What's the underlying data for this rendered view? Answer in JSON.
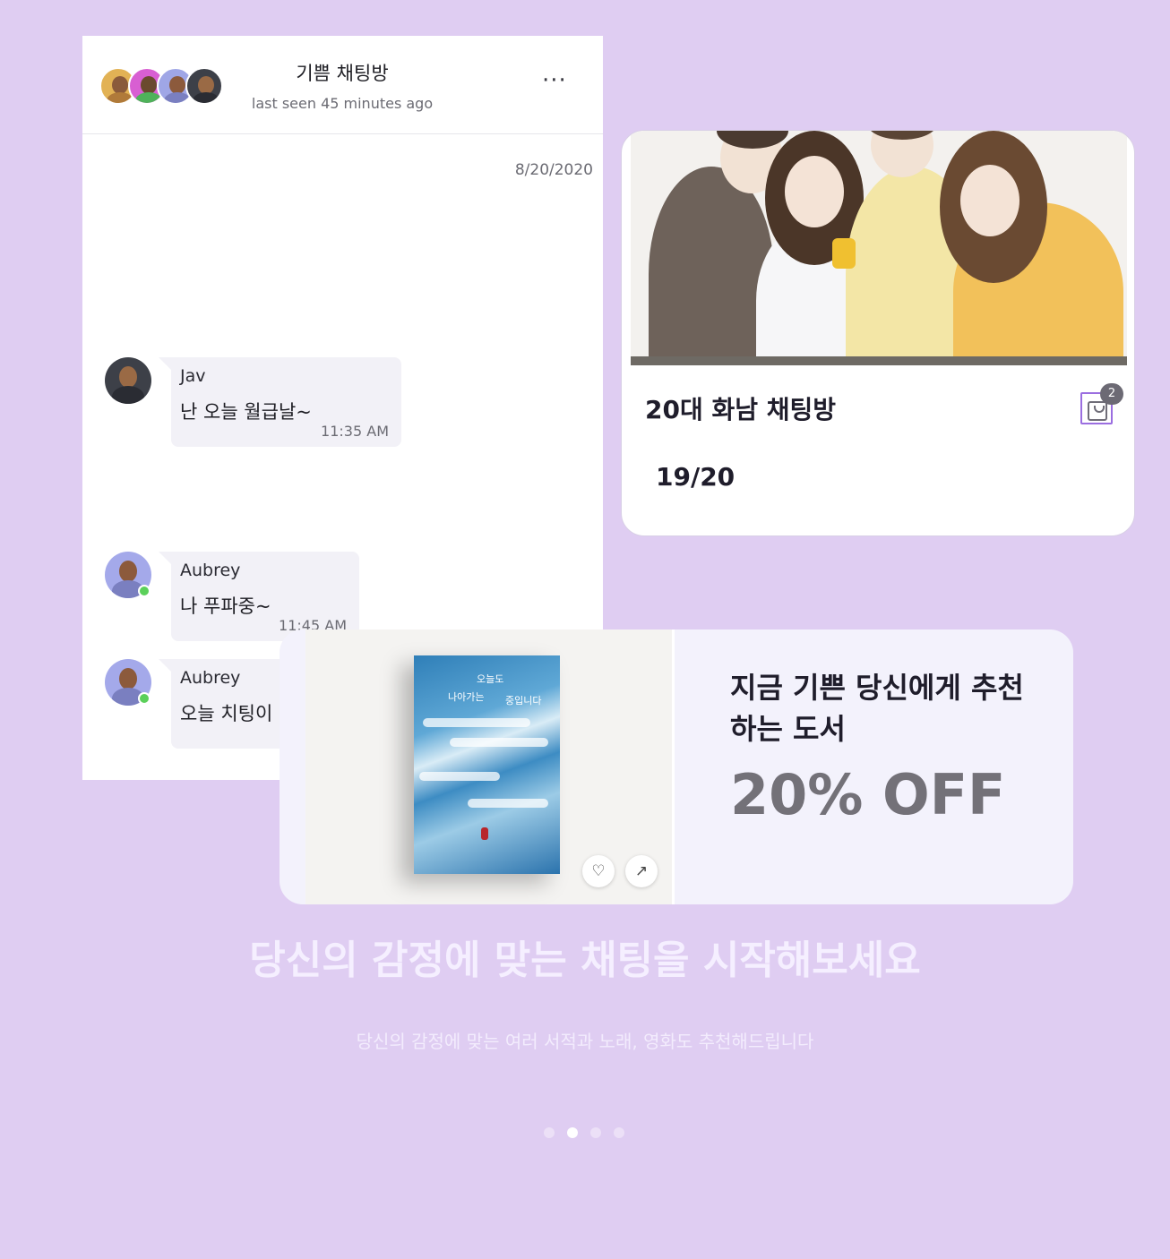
{
  "chat": {
    "title": "기쁨 채팅방",
    "subtitle": "last seen 45 minutes ago",
    "date": "8/20/2020",
    "messages": [
      {
        "sender": "Jav",
        "text": "난 오늘 월급날~",
        "time": "11:35 AM"
      },
      {
        "sender": "Aubrey",
        "text": "나 푸파중~",
        "time": "11:45 AM"
      },
      {
        "sender": "Aubrey",
        "text": "오늘 치팅이",
        "time": ""
      }
    ]
  },
  "group_card": {
    "title": "20대 화남 채팅방",
    "badge_count": "2",
    "member_count": "19/20"
  },
  "book_card": {
    "headline_line1": "지금 기쁜 당신에게 추천",
    "headline_line2": "하는 도서",
    "discount": "20% OFF",
    "book_cover_text_1": "오늘도",
    "book_cover_text_2": "나아가는",
    "book_cover_text_3": "중입니다"
  },
  "footer": {
    "headline": "당신의 감정에 맞는 채팅을 시작해보세요",
    "subline": "당신의 감정에 맞는 여러 서적과 노래, 영화도 추천해드립니다"
  },
  "icons": {
    "more": "more-dots-icon",
    "bag": "shopping-bag-icon",
    "like": "heart-icon",
    "share": "share-icon"
  },
  "colors": {
    "background": "#dfcdf2",
    "accent": "#9b6ee0",
    "online": "#5bd05a"
  },
  "pagination": {
    "total": 4,
    "active_index": 1
  }
}
